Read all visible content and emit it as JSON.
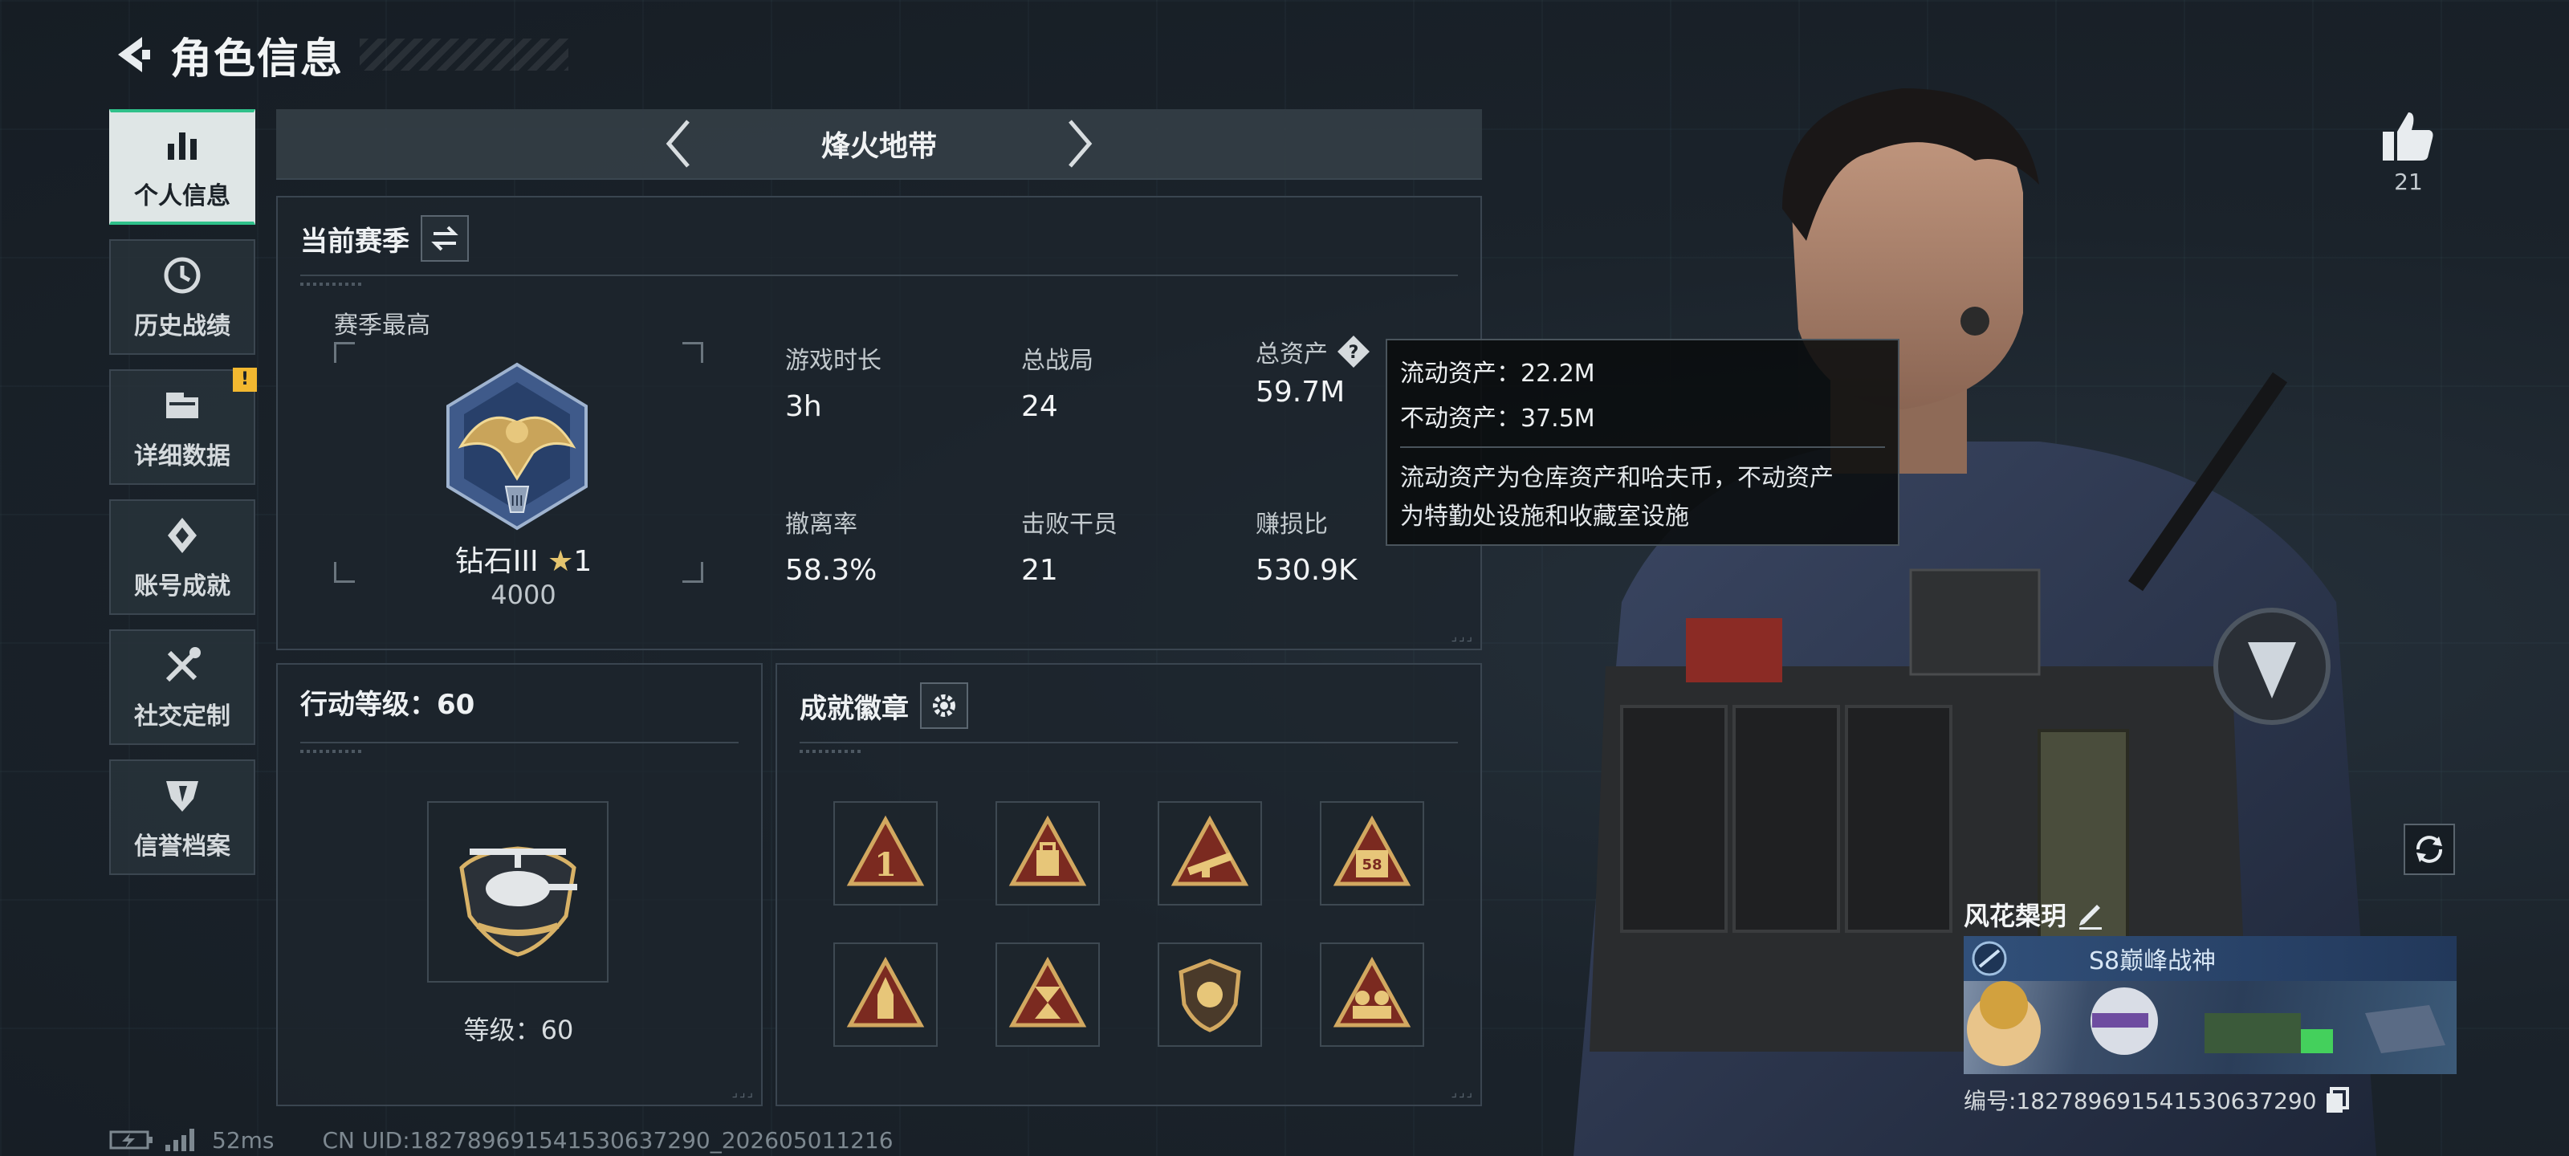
{
  "header": {
    "title": "角色信息"
  },
  "sidebar": {
    "items": [
      {
        "label": "个人信息",
        "icon": "bar-chart-icon",
        "active": true
      },
      {
        "label": "历史战绩",
        "icon": "history-clock-icon"
      },
      {
        "label": "详细数据",
        "icon": "folder-icon",
        "alert": "!"
      },
      {
        "label": "账号成就",
        "icon": "achievement-icon"
      },
      {
        "label": "社交定制",
        "icon": "tools-icon"
      },
      {
        "label": "信誉档案",
        "icon": "reputation-icon"
      }
    ]
  },
  "mode": {
    "title": "烽火地带"
  },
  "season": {
    "title": "当前赛季",
    "best_label": "赛季最高",
    "rank_name": "钻石III",
    "rank_stars": "1",
    "rank_score": "4000",
    "stats": [
      {
        "label": "游戏时长",
        "value": "3h"
      },
      {
        "label": "总战局",
        "value": "24"
      },
      {
        "label": "总资产",
        "value": "59.7M"
      },
      {
        "label": "撤离率",
        "value": "58.3%"
      },
      {
        "label": "击败干员",
        "value": "21"
      },
      {
        "label": "赚损比",
        "value": "530.9K"
      }
    ]
  },
  "tooltip": {
    "liquid": "流动资产：22.2M",
    "fixed": "不动资产：37.5M",
    "desc_line1": "流动资产为仓库资产和哈夫币，不动资产",
    "desc_line2": "为特勤处设施和收藏室设施"
  },
  "action_level": {
    "title": "行动等级：60",
    "level_text": "等级：60"
  },
  "achievements": {
    "title": "成就徽章",
    "badges": [
      "triangle-badge-one-icon",
      "triangle-badge-backpack-icon",
      "triangle-badge-weapon-icon",
      "triangle-badge-58-icon",
      "triangle-badge-rocket-icon",
      "triangle-badge-hourglass-icon",
      "shield-badge-icon",
      "triangle-badge-team-icon"
    ]
  },
  "likes": {
    "count": "21"
  },
  "player": {
    "name": "风花槼玥",
    "title": "S8巅峰战神",
    "uid": "编号:1827896915415306372​90"
  },
  "status": {
    "ping": "52ms",
    "uid_line": "CN UID:182789691541530637290_202605011216"
  },
  "colors": {
    "accent_green": "#2fc08a",
    "alert_yellow": "#f2b830",
    "panel_bg": "#1e262e"
  }
}
